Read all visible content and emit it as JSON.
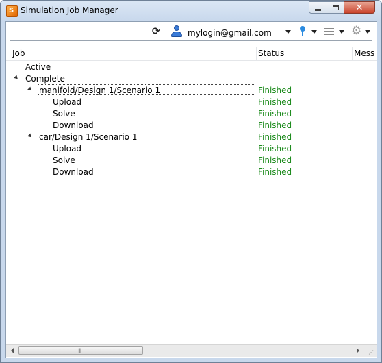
{
  "window": {
    "title": "Simulation Job Manager",
    "accent_close": "#c9432b"
  },
  "toolbar": {
    "refresh_icon": "refresh-icon",
    "account": "mylogin@gmail.com",
    "icons": [
      "user-icon",
      "probe-icon",
      "list-icon",
      "gear-icon"
    ]
  },
  "columns": {
    "job": "Job",
    "status": "Status",
    "message": "Mess"
  },
  "tree": [
    {
      "label": "Active",
      "status": "",
      "level": 0,
      "expander": false
    },
    {
      "label": "Complete",
      "status": "",
      "level": 0,
      "expander": true
    },
    {
      "label": "manifold/Design 1/Scenario 1",
      "status": "Finished",
      "level": 1,
      "expander": true,
      "focused": true
    },
    {
      "label": "Upload",
      "status": "Finished",
      "level": 2,
      "expander": false
    },
    {
      "label": "Solve",
      "status": "Finished",
      "level": 2,
      "expander": false
    },
    {
      "label": "Download",
      "status": "Finished",
      "level": 2,
      "expander": false
    },
    {
      "label": "car/Design 1/Scenario 1",
      "status": "Finished",
      "level": 1,
      "expander": true
    },
    {
      "label": "Upload",
      "status": "Finished",
      "level": 2,
      "expander": false
    },
    {
      "label": "Solve",
      "status": "Finished",
      "level": 2,
      "expander": false
    },
    {
      "label": "Download",
      "status": "Finished",
      "level": 2,
      "expander": false
    }
  ],
  "colors": {
    "status_finished": "#1f8c1f"
  }
}
